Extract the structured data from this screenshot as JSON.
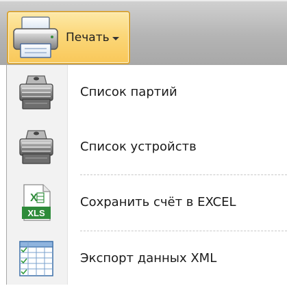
{
  "toolbar": {
    "print_button": {
      "label": "Печать",
      "icon": "printer-icon"
    }
  },
  "menu": {
    "items": [
      {
        "label": "Список партий",
        "icon": "printer-icon"
      },
      {
        "label": "Список устройств",
        "icon": "printer-icon"
      },
      {
        "label": "Сохранить счёт в EXCEL",
        "icon": "excel-xls-icon",
        "icon_text": "XLS"
      },
      {
        "label": "Экспорт данных XML",
        "icon": "table-grid-icon"
      }
    ]
  },
  "colors": {
    "button_highlight": "#fbd779",
    "button_border": "#d8a53a",
    "ribbon": "#b4b4b4",
    "excel_green": "#2e8b3a"
  }
}
